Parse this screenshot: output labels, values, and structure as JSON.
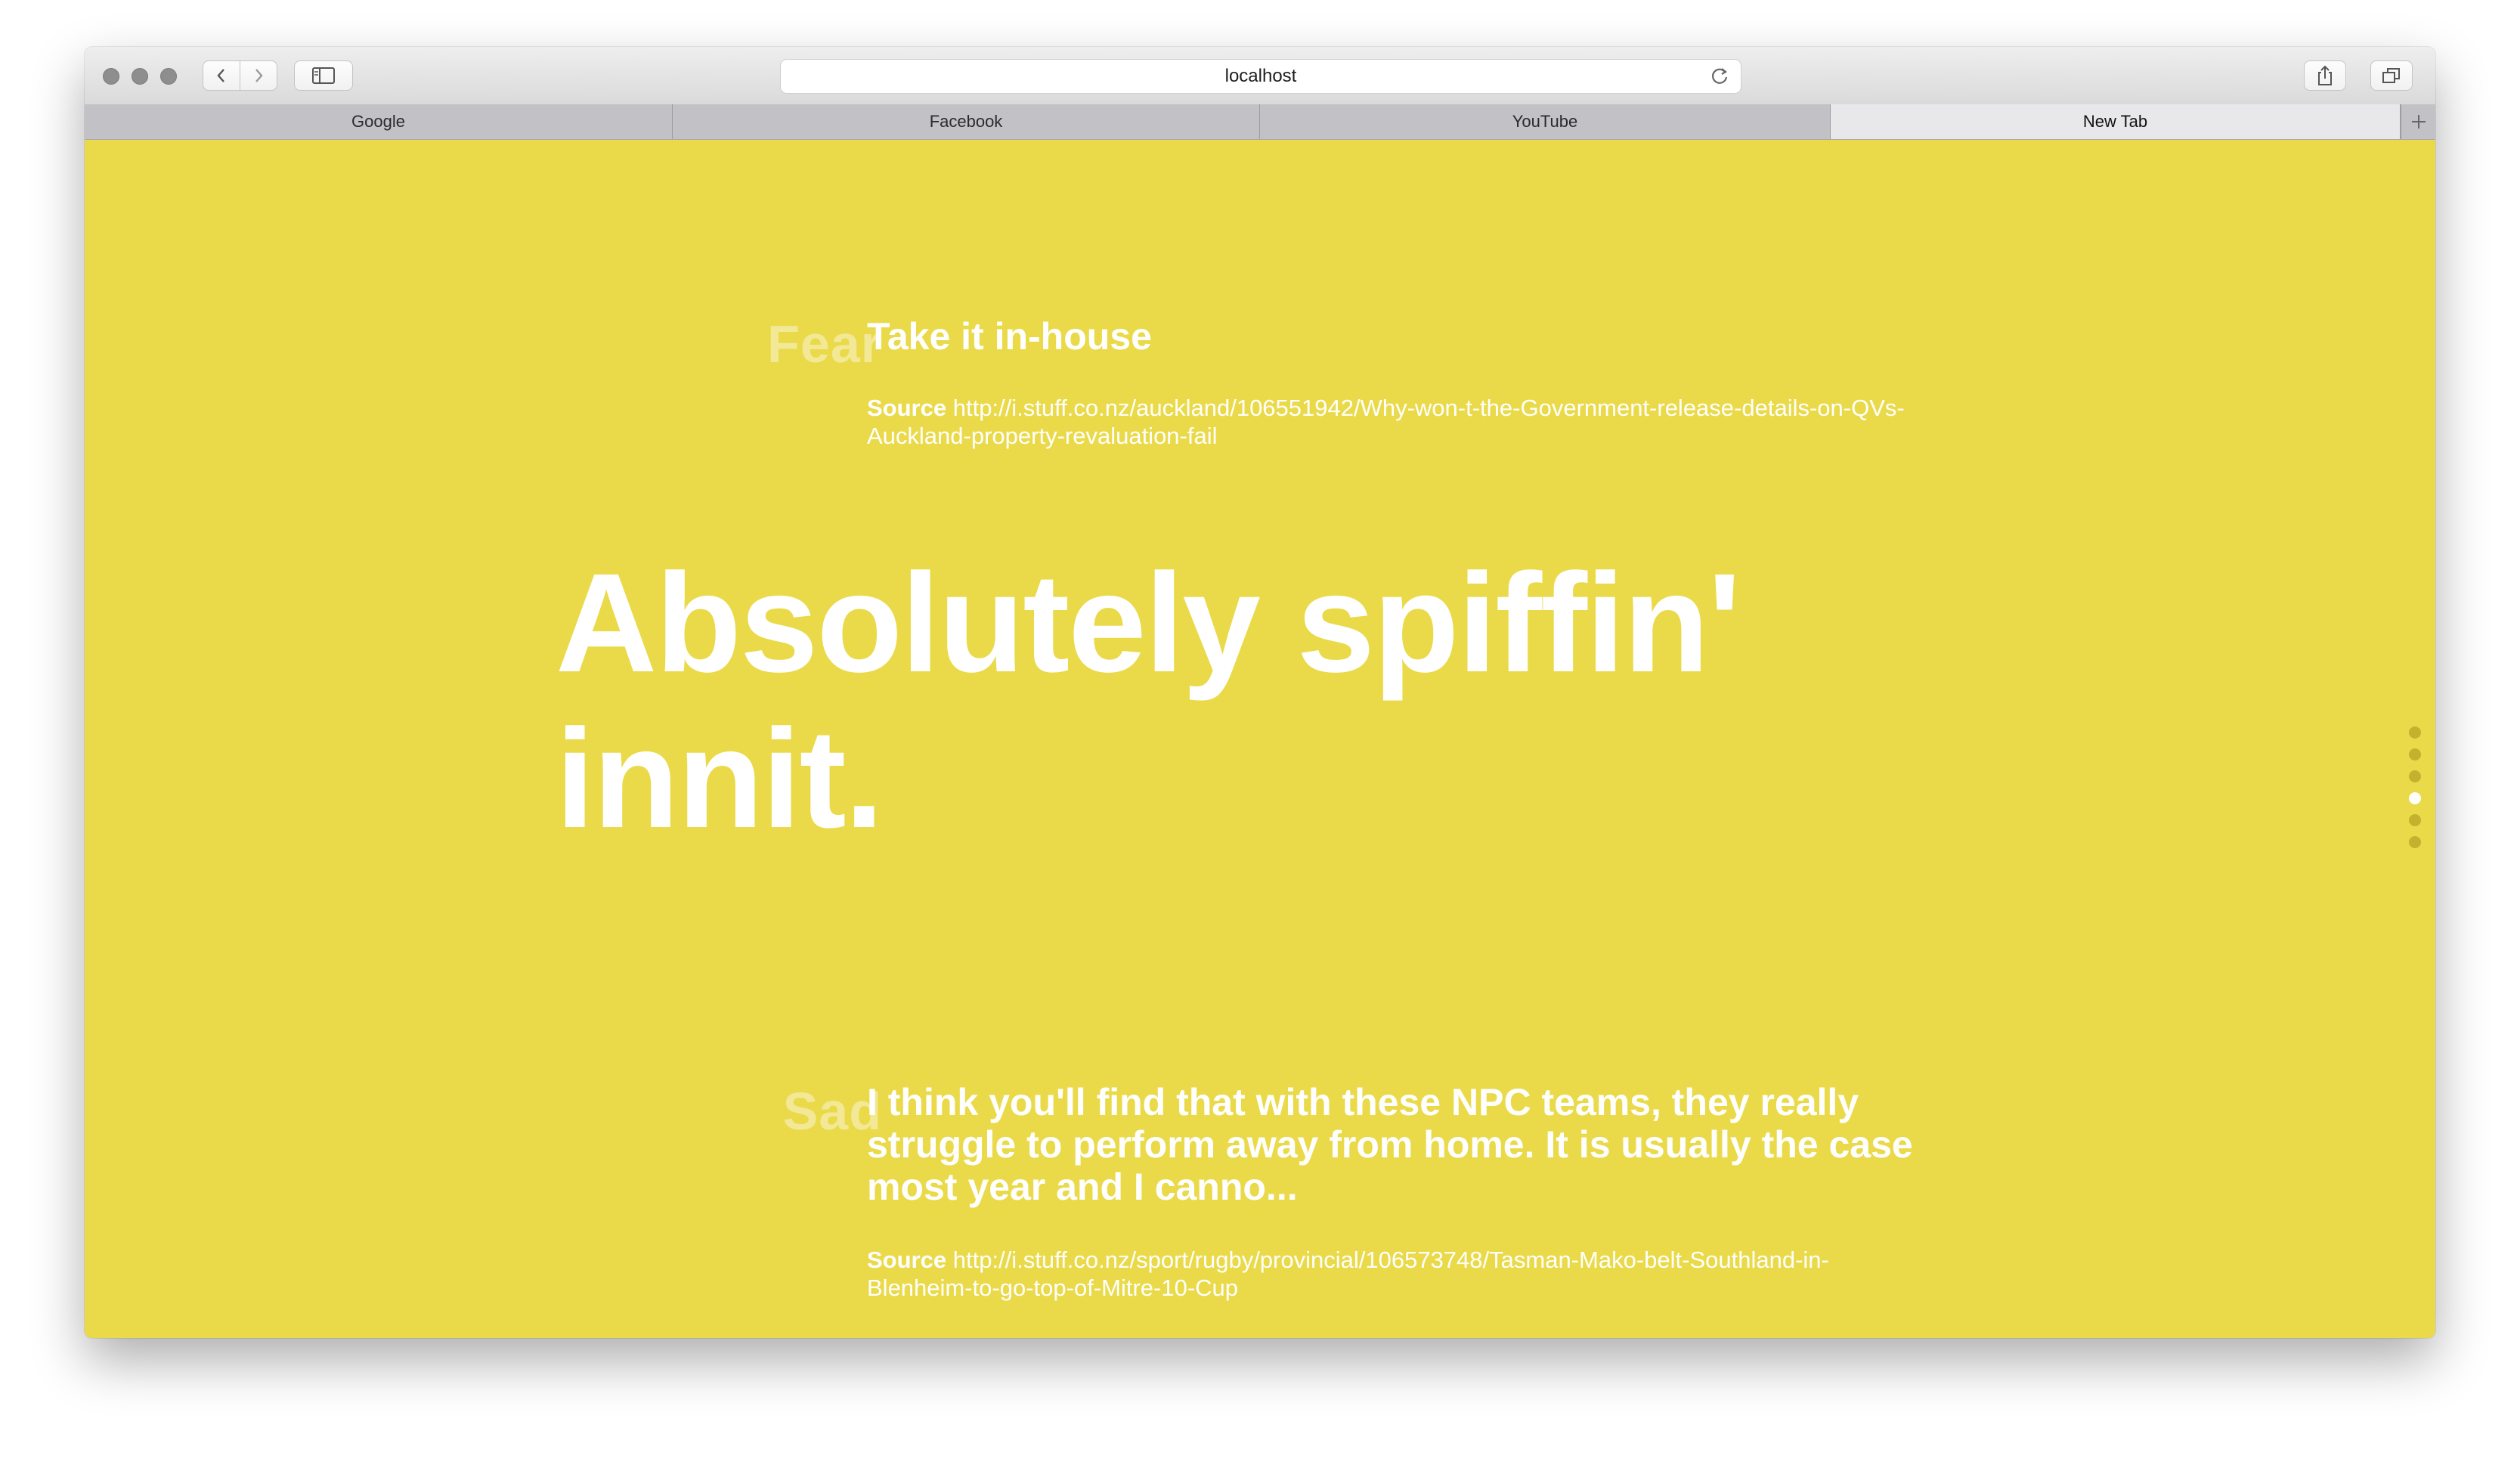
{
  "browser": {
    "url": "localhost",
    "tabs": [
      {
        "label": "Google",
        "active": false
      },
      {
        "label": "Facebook",
        "active": false
      },
      {
        "label": "YouTube",
        "active": false
      },
      {
        "label": "New Tab",
        "active": true
      }
    ]
  },
  "page": {
    "background": "#EADA4A",
    "top_item": {
      "emotion": "Fear",
      "headline": "Take it in-house",
      "source_label": "Source",
      "source_url": "http://i.stuff.co.nz/auckland/106551942/Why-won-t-the-Government-release-details-on-QVs-Auckland-property-revaluation-fail"
    },
    "hero_line1": "Absolutely spiffin'",
    "hero_line2": "innit.",
    "bottom_item": {
      "emotion": "Sad",
      "headline": "I think you'll find that with these NPC teams, they really struggle to perform away from home.  It is usually the case most year and I canno...",
      "source_label": "Source",
      "source_url": "http://i.stuff.co.nz/sport/rugby/provincial/106573748/Tasman-Mako-belt-Southland-in-Blenheim-to-go-top-of-Mitre-10-Cup"
    },
    "pager": {
      "count": 6,
      "active_index": 3
    }
  }
}
